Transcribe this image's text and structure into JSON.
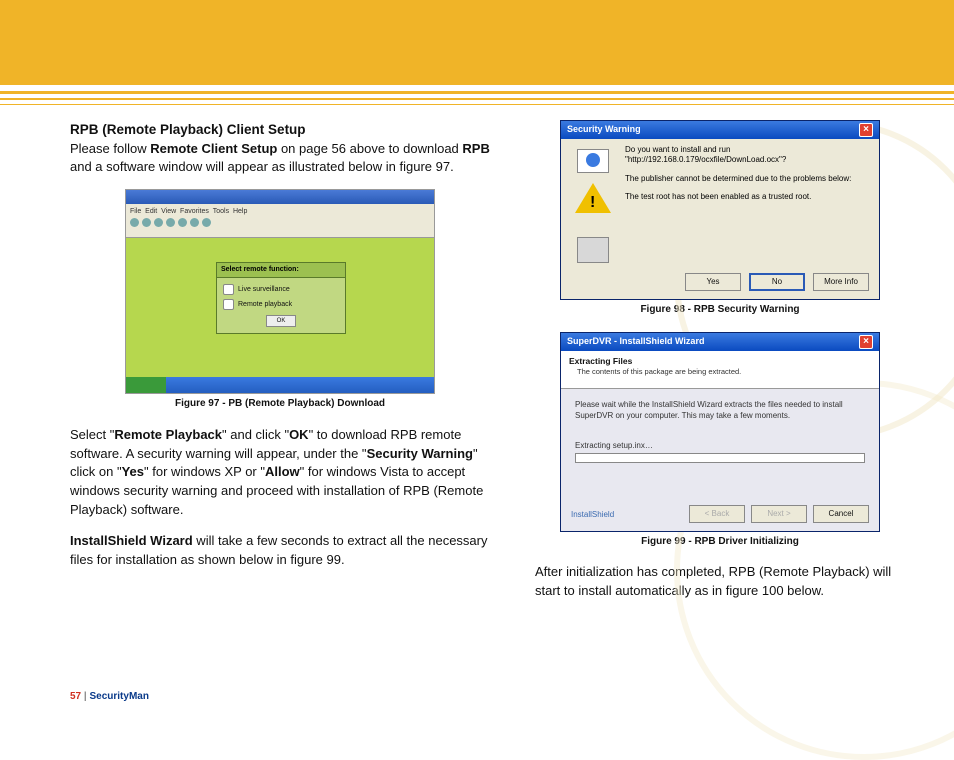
{
  "page": {
    "footer_num": "57",
    "footer_bar": " | ",
    "footer_brand": "SecurityMan"
  },
  "left": {
    "heading": "RPB (Remote Playback) Client Setup",
    "p1a": "Please follow ",
    "p1b": "Remote Client Setup",
    "p1c": " on page 56 above to download ",
    "p1d": "RPB",
    "p1e": " and a software window will appear as illustrated below in figure 97.",
    "fig97_caption": "Figure 97  - PB (Remote Playback) Download",
    "p2a": "Select \"",
    "p2b": "Remote Playback",
    "p2c": "\" and click \"",
    "p2d": "OK",
    "p2e": "\" to download RPB remote software. A security warning will appear, under the \"",
    "p2f": "Security Warning",
    "p2g": "\" click on \"",
    "p2h": "Yes",
    "p2i": "\" for windows XP or \"",
    "p2j": "Allow",
    "p2k": "\" for windows Vista to accept windows security warning and proceed with installation of RPB (Remote Playback) software.",
    "p3a": "InstallShield Wizard",
    "p3b": " will take a few seconds to extract all the necessary files for installation as shown below in figure 99."
  },
  "fig97": {
    "dialog_title": "Select remote function:",
    "opt1": "Live surveillance",
    "opt2": "Remote playback",
    "ok": "OK"
  },
  "fig98": {
    "title": "Security Warning",
    "line1": "Do you want to install and run \"http://192.168.0.179/ocxfile/DownLoad.ocx\"?",
    "line2": "The publisher cannot be determined due to the problems below:",
    "line3": "The test root has not been enabled as a trusted root.",
    "btn_yes": "Yes",
    "btn_no": "No",
    "btn_more": "More Info",
    "caption": "Figure 98 - RPB Security Warning"
  },
  "fig99": {
    "title": "SuperDVR - InstallShield Wizard",
    "head1": "Extracting Files",
    "head2": "The contents of this package are being extracted.",
    "body1": "Please wait while the InstallShield Wizard extracts the files needed to install SuperDVR on your computer. This may take a few moments.",
    "proglabel": "Extracting setup.inx…",
    "brand": "InstallShield",
    "btn_back": "< Back",
    "btn_next": "Next >",
    "btn_cancel": "Cancel",
    "caption": "Figure 99 - RPB Driver Initializing"
  },
  "right": {
    "p1": "After initialization has completed, RPB (Remote Playback) will start to install automatically as in figure 100 below."
  }
}
